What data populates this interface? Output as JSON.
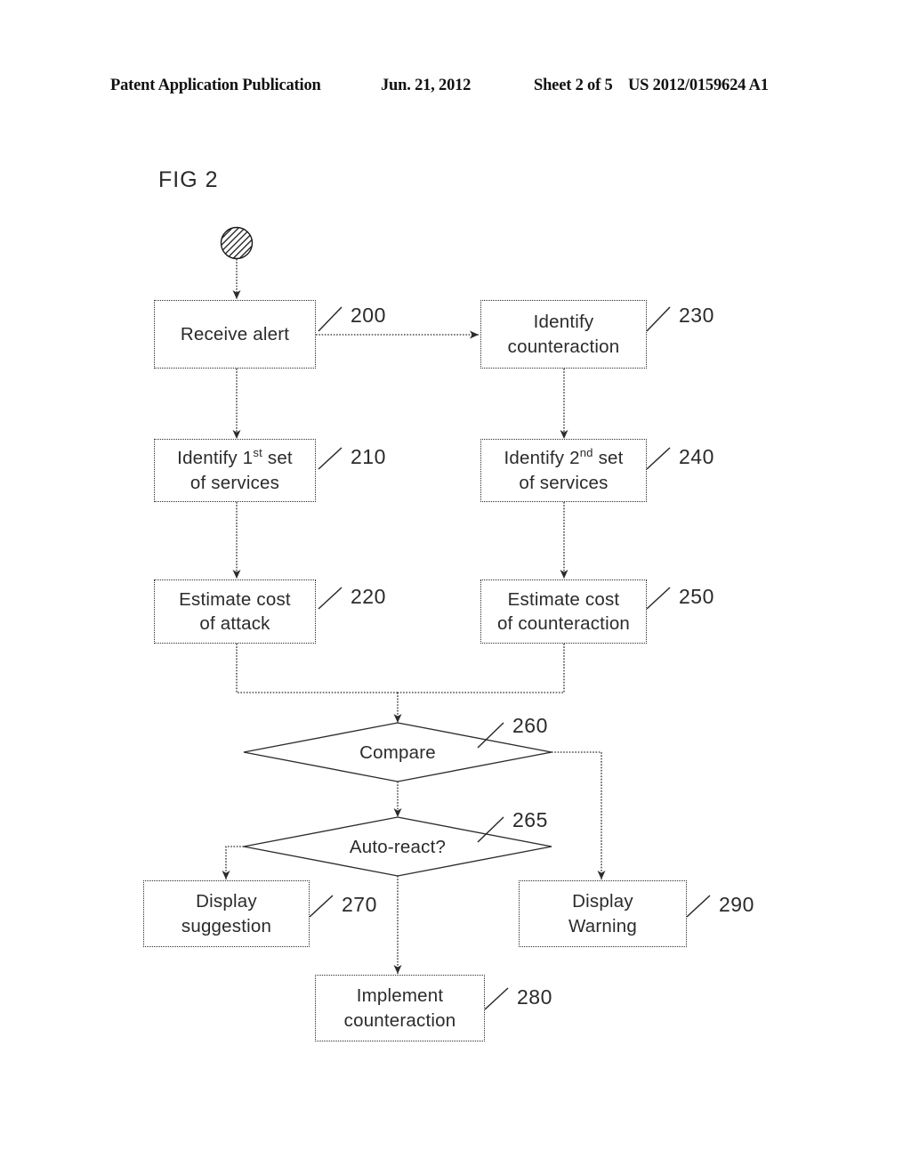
{
  "header": {
    "publication": "Patent Application Publication",
    "date": "Jun. 21, 2012",
    "sheet": "Sheet 2 of 5",
    "number": "US 2012/0159624 A1"
  },
  "figure": {
    "label": "FIG 2"
  },
  "diagram": {
    "start_node": "start-node",
    "nodes": [
      {
        "id": "n200",
        "ref": "200",
        "line1": "Receive alert",
        "line2": ""
      },
      {
        "id": "n230",
        "ref": "230",
        "line1": "Identify",
        "line2": "counteraction"
      },
      {
        "id": "n210",
        "ref": "210",
        "line1": "Identify 1st set",
        "line2": "of services",
        "sup": "st",
        "prefix": "Identify 1",
        "suffix": " set"
      },
      {
        "id": "n240",
        "ref": "240",
        "line1": "Identify 2nd set",
        "line2": "of services",
        "sup": "nd",
        "prefix": "Identify 2",
        "suffix": " set"
      },
      {
        "id": "n220",
        "ref": "220",
        "line1": "Estimate cost",
        "line2": "of attack"
      },
      {
        "id": "n250",
        "ref": "250",
        "line1": "Estimate cost",
        "line2": "of counteraction"
      },
      {
        "id": "n270",
        "ref": "270",
        "line1": "Display",
        "line2": "suggestion"
      },
      {
        "id": "n290",
        "ref": "290",
        "line1": "Display",
        "line2": "Warning"
      },
      {
        "id": "n280",
        "ref": "280",
        "line1": "Implement",
        "line2": "counteraction"
      }
    ],
    "decisions": [
      {
        "id": "d260",
        "ref": "260",
        "label": "Compare"
      },
      {
        "id": "d265",
        "ref": "265",
        "label": "Auto-react?"
      }
    ],
    "colors": {
      "ink": "#2b2b2b",
      "background": "#ffffff"
    }
  }
}
